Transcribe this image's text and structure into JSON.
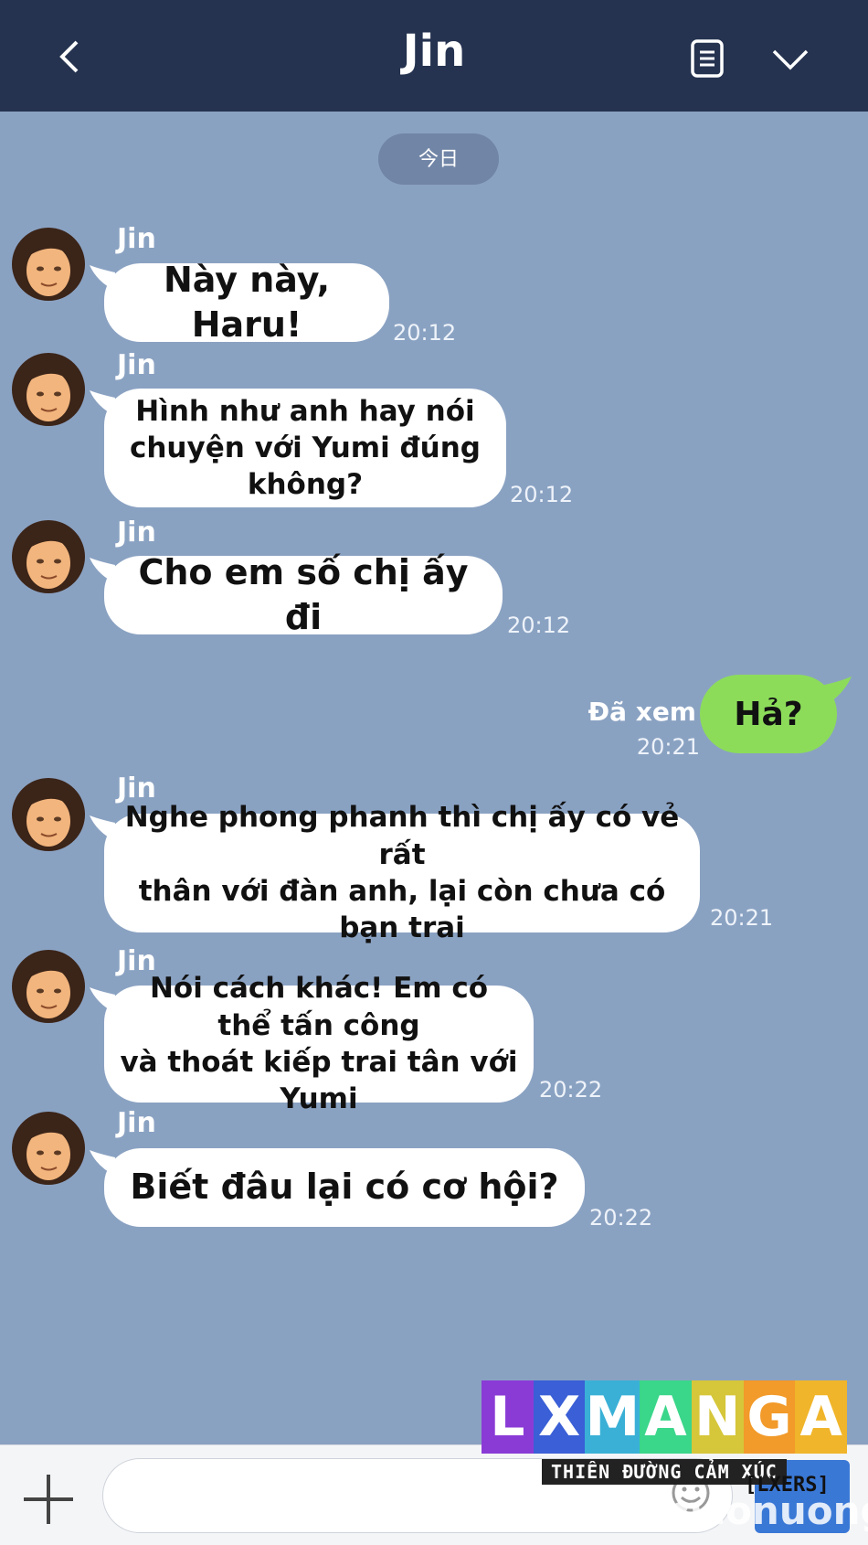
{
  "header": {
    "title": "Jin"
  },
  "date_divider": "今日",
  "messages": [
    {
      "sender": "Jin",
      "lines": [
        "Này này, Haru!"
      ],
      "time": "20:12"
    },
    {
      "sender": "Jin",
      "lines": [
        "Hình như anh hay nói",
        "chuyện với Yumi đúng không?"
      ],
      "time": "20:12"
    },
    {
      "sender": "Jin",
      "lines": [
        "Cho em số chị ấy đi"
      ],
      "time": "20:12"
    },
    {
      "sender": "Jin",
      "lines": [
        "Nghe phong phanh thì chị ấy có vẻ rất",
        "thân với đàn anh, lại còn chưa có bạn trai"
      ],
      "time": "20:21"
    },
    {
      "sender": "Jin",
      "lines": [
        "Nói cách khác! Em có thể tấn công",
        "và thoát kiếp trai tân với Yumi"
      ],
      "time": "20:22"
    },
    {
      "sender": "Jin",
      "lines": [
        "Biết đâu lại có cơ hội?"
      ],
      "time": "20:22"
    }
  ],
  "sent": {
    "text": "Hả?",
    "read_label": "Đã xem",
    "time": "20:21"
  },
  "watermark": {
    "brand_letters": [
      "L",
      "X",
      "M",
      "A",
      "N",
      "G",
      "A"
    ],
    "brand_colors": [
      "#8a3bd6",
      "#3a5fd6",
      "#3ab0d6",
      "#3ad68a",
      "#d6c63a",
      "#f29a2a",
      "#f0b52a"
    ],
    "tagline": "THIÊN ĐƯỜNG CẢM XÚC",
    "lxers": "[LXERS]",
    "site": "damconuong"
  },
  "colors": {
    "topbar": "#253350",
    "background": "#8aa2c2",
    "sent_bubble": "#8cdc5a"
  }
}
